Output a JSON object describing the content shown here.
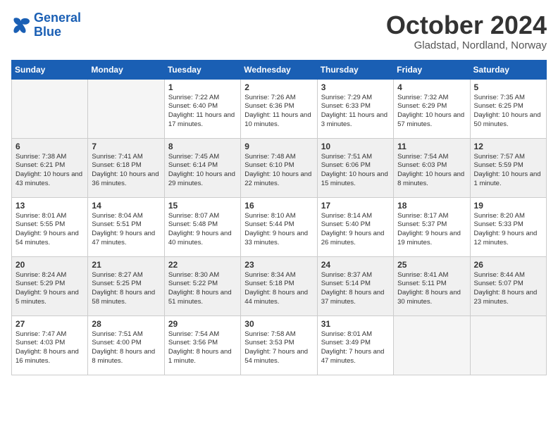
{
  "header": {
    "logo_line1": "General",
    "logo_line2": "Blue",
    "month": "October 2024",
    "location": "Gladstad, Nordland, Norway"
  },
  "weekdays": [
    "Sunday",
    "Monday",
    "Tuesday",
    "Wednesday",
    "Thursday",
    "Friday",
    "Saturday"
  ],
  "weeks": [
    [
      {
        "day": "",
        "empty": true
      },
      {
        "day": "",
        "empty": true
      },
      {
        "day": "1",
        "sunrise": "Sunrise: 7:22 AM",
        "sunset": "Sunset: 6:40 PM",
        "daylight": "Daylight: 11 hours and 17 minutes."
      },
      {
        "day": "2",
        "sunrise": "Sunrise: 7:26 AM",
        "sunset": "Sunset: 6:36 PM",
        "daylight": "Daylight: 11 hours and 10 minutes."
      },
      {
        "day": "3",
        "sunrise": "Sunrise: 7:29 AM",
        "sunset": "Sunset: 6:33 PM",
        "daylight": "Daylight: 11 hours and 3 minutes."
      },
      {
        "day": "4",
        "sunrise": "Sunrise: 7:32 AM",
        "sunset": "Sunset: 6:29 PM",
        "daylight": "Daylight: 10 hours and 57 minutes."
      },
      {
        "day": "5",
        "sunrise": "Sunrise: 7:35 AM",
        "sunset": "Sunset: 6:25 PM",
        "daylight": "Daylight: 10 hours and 50 minutes."
      }
    ],
    [
      {
        "day": "6",
        "sunrise": "Sunrise: 7:38 AM",
        "sunset": "Sunset: 6:21 PM",
        "daylight": "Daylight: 10 hours and 43 minutes."
      },
      {
        "day": "7",
        "sunrise": "Sunrise: 7:41 AM",
        "sunset": "Sunset: 6:18 PM",
        "daylight": "Daylight: 10 hours and 36 minutes."
      },
      {
        "day": "8",
        "sunrise": "Sunrise: 7:45 AM",
        "sunset": "Sunset: 6:14 PM",
        "daylight": "Daylight: 10 hours and 29 minutes."
      },
      {
        "day": "9",
        "sunrise": "Sunrise: 7:48 AM",
        "sunset": "Sunset: 6:10 PM",
        "daylight": "Daylight: 10 hours and 22 minutes."
      },
      {
        "day": "10",
        "sunrise": "Sunrise: 7:51 AM",
        "sunset": "Sunset: 6:06 PM",
        "daylight": "Daylight: 10 hours and 15 minutes."
      },
      {
        "day": "11",
        "sunrise": "Sunrise: 7:54 AM",
        "sunset": "Sunset: 6:03 PM",
        "daylight": "Daylight: 10 hours and 8 minutes."
      },
      {
        "day": "12",
        "sunrise": "Sunrise: 7:57 AM",
        "sunset": "Sunset: 5:59 PM",
        "daylight": "Daylight: 10 hours and 1 minute."
      }
    ],
    [
      {
        "day": "13",
        "sunrise": "Sunrise: 8:01 AM",
        "sunset": "Sunset: 5:55 PM",
        "daylight": "Daylight: 9 hours and 54 minutes."
      },
      {
        "day": "14",
        "sunrise": "Sunrise: 8:04 AM",
        "sunset": "Sunset: 5:51 PM",
        "daylight": "Daylight: 9 hours and 47 minutes."
      },
      {
        "day": "15",
        "sunrise": "Sunrise: 8:07 AM",
        "sunset": "Sunset: 5:48 PM",
        "daylight": "Daylight: 9 hours and 40 minutes."
      },
      {
        "day": "16",
        "sunrise": "Sunrise: 8:10 AM",
        "sunset": "Sunset: 5:44 PM",
        "daylight": "Daylight: 9 hours and 33 minutes."
      },
      {
        "day": "17",
        "sunrise": "Sunrise: 8:14 AM",
        "sunset": "Sunset: 5:40 PM",
        "daylight": "Daylight: 9 hours and 26 minutes."
      },
      {
        "day": "18",
        "sunrise": "Sunrise: 8:17 AM",
        "sunset": "Sunset: 5:37 PM",
        "daylight": "Daylight: 9 hours and 19 minutes."
      },
      {
        "day": "19",
        "sunrise": "Sunrise: 8:20 AM",
        "sunset": "Sunset: 5:33 PM",
        "daylight": "Daylight: 9 hours and 12 minutes."
      }
    ],
    [
      {
        "day": "20",
        "sunrise": "Sunrise: 8:24 AM",
        "sunset": "Sunset: 5:29 PM",
        "daylight": "Daylight: 9 hours and 5 minutes."
      },
      {
        "day": "21",
        "sunrise": "Sunrise: 8:27 AM",
        "sunset": "Sunset: 5:25 PM",
        "daylight": "Daylight: 8 hours and 58 minutes."
      },
      {
        "day": "22",
        "sunrise": "Sunrise: 8:30 AM",
        "sunset": "Sunset: 5:22 PM",
        "daylight": "Daylight: 8 hours and 51 minutes."
      },
      {
        "day": "23",
        "sunrise": "Sunrise: 8:34 AM",
        "sunset": "Sunset: 5:18 PM",
        "daylight": "Daylight: 8 hours and 44 minutes."
      },
      {
        "day": "24",
        "sunrise": "Sunrise: 8:37 AM",
        "sunset": "Sunset: 5:14 PM",
        "daylight": "Daylight: 8 hours and 37 minutes."
      },
      {
        "day": "25",
        "sunrise": "Sunrise: 8:41 AM",
        "sunset": "Sunset: 5:11 PM",
        "daylight": "Daylight: 8 hours and 30 minutes."
      },
      {
        "day": "26",
        "sunrise": "Sunrise: 8:44 AM",
        "sunset": "Sunset: 5:07 PM",
        "daylight": "Daylight: 8 hours and 23 minutes."
      }
    ],
    [
      {
        "day": "27",
        "sunrise": "Sunrise: 7:47 AM",
        "sunset": "Sunset: 4:03 PM",
        "daylight": "Daylight: 8 hours and 16 minutes."
      },
      {
        "day": "28",
        "sunrise": "Sunrise: 7:51 AM",
        "sunset": "Sunset: 4:00 PM",
        "daylight": "Daylight: 8 hours and 8 minutes."
      },
      {
        "day": "29",
        "sunrise": "Sunrise: 7:54 AM",
        "sunset": "Sunset: 3:56 PM",
        "daylight": "Daylight: 8 hours and 1 minute."
      },
      {
        "day": "30",
        "sunrise": "Sunrise: 7:58 AM",
        "sunset": "Sunset: 3:53 PM",
        "daylight": "Daylight: 7 hours and 54 minutes."
      },
      {
        "day": "31",
        "sunrise": "Sunrise: 8:01 AM",
        "sunset": "Sunset: 3:49 PM",
        "daylight": "Daylight: 7 hours and 47 minutes."
      },
      {
        "day": "",
        "empty": true
      },
      {
        "day": "",
        "empty": true
      }
    ]
  ]
}
